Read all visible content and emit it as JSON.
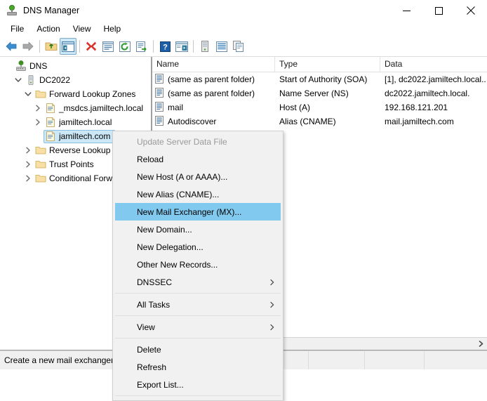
{
  "window": {
    "title": "DNS Manager",
    "icon": "dns-server-icon",
    "minimize_label": "Minimize",
    "maximize_label": "Maximize",
    "close_label": "Close"
  },
  "menubar": {
    "items": [
      {
        "label": "File",
        "name": "menu-file"
      },
      {
        "label": "Action",
        "name": "menu-action"
      },
      {
        "label": "View",
        "name": "menu-view"
      },
      {
        "label": "Help",
        "name": "menu-help"
      }
    ]
  },
  "toolbar": {
    "buttons": [
      {
        "icon": "back-arrow-icon",
        "active": false
      },
      {
        "icon": "forward-arrow-icon",
        "active": false
      },
      {
        "icon": "up-folder-icon",
        "active": false
      },
      {
        "icon": "show-hide-console-tree-icon",
        "active": true
      },
      {
        "icon": "delete-red-x-icon",
        "active": false
      },
      {
        "icon": "properties-icon",
        "active": false
      },
      {
        "icon": "refresh-icon",
        "active": false
      },
      {
        "icon": "export-list-icon",
        "active": false
      },
      {
        "icon": "help-icon",
        "active": false
      },
      {
        "icon": "show-window-icon",
        "active": false
      },
      {
        "icon": "server-icon",
        "active": false
      },
      {
        "icon": "list-view-icon",
        "active": false
      },
      {
        "icon": "copy-icon",
        "active": false
      }
    ]
  },
  "tree": {
    "items": [
      {
        "label": "DNS",
        "indent": 0,
        "icon": "dns-root-icon",
        "expander": "none",
        "selected": false
      },
      {
        "label": "DC2022",
        "indent": 1,
        "icon": "server-tower-icon",
        "expander": "expanded",
        "selected": false
      },
      {
        "label": "Forward Lookup Zones",
        "indent": 2,
        "icon": "folder-icon",
        "expander": "expanded",
        "selected": false
      },
      {
        "label": "_msdcs.jamiltech.local",
        "indent": 3,
        "icon": "zone-icon",
        "expander": "collapsed",
        "selected": false
      },
      {
        "label": "jamiltech.local",
        "indent": 3,
        "icon": "zone-icon",
        "expander": "collapsed",
        "selected": false
      },
      {
        "label": "jamiltech.com",
        "indent": 3,
        "icon": "zone-icon",
        "expander": "none",
        "selected": true
      },
      {
        "label": "Reverse Lookup Zones",
        "indent": 2,
        "icon": "folder-icon",
        "expander": "collapsed",
        "selected": false
      },
      {
        "label": "Trust Points",
        "indent": 2,
        "icon": "folder-icon",
        "expander": "collapsed",
        "selected": false
      },
      {
        "label": "Conditional Forwarders",
        "indent": 2,
        "icon": "folder-icon",
        "expander": "collapsed",
        "selected": false
      }
    ]
  },
  "list": {
    "columns": [
      {
        "label": "Name"
      },
      {
        "label": "Type"
      },
      {
        "label": "Data"
      }
    ],
    "rows": [
      {
        "name": "(same as parent folder)",
        "type": "Start of Authority (SOA)",
        "data": "[1], dc2022.jamiltech.local.."
      },
      {
        "name": "(same as parent folder)",
        "type": "Name Server (NS)",
        "data": "dc2022.jamiltech.local."
      },
      {
        "name": "mail",
        "type": "Host (A)",
        "data": "192.168.121.201"
      },
      {
        "name": "Autodiscover",
        "type": "Alias (CNAME)",
        "data": "mail.jamiltech.com"
      }
    ]
  },
  "context_menu": {
    "items": [
      {
        "label": "Update Server Data File",
        "state": "disabled",
        "submenu": false,
        "separator_after": false
      },
      {
        "label": "Reload",
        "state": "normal",
        "submenu": false,
        "separator_after": false
      },
      {
        "label": "New Host (A or AAAA)...",
        "state": "normal",
        "submenu": false,
        "separator_after": false
      },
      {
        "label": "New Alias (CNAME)...",
        "state": "normal",
        "submenu": false,
        "separator_after": false
      },
      {
        "label": "New Mail Exchanger (MX)...",
        "state": "highlight",
        "submenu": false,
        "separator_after": false
      },
      {
        "label": "New Domain...",
        "state": "normal",
        "submenu": false,
        "separator_after": false
      },
      {
        "label": "New Delegation...",
        "state": "normal",
        "submenu": false,
        "separator_after": false
      },
      {
        "label": "Other New Records...",
        "state": "normal",
        "submenu": false,
        "separator_after": false
      },
      {
        "label": "DNSSEC",
        "state": "normal",
        "submenu": true,
        "separator_after": true
      },
      {
        "label": "All Tasks",
        "state": "normal",
        "submenu": true,
        "separator_after": true
      },
      {
        "label": "View",
        "state": "normal",
        "submenu": true,
        "separator_after": true
      },
      {
        "label": "Delete",
        "state": "normal",
        "submenu": false,
        "separator_after": false
      },
      {
        "label": "Refresh",
        "state": "normal",
        "submenu": false,
        "separator_after": false
      },
      {
        "label": "Export List...",
        "state": "normal",
        "submenu": false,
        "separator_after": true
      }
    ]
  },
  "statusbar": {
    "message": "Create a new mail exchanger",
    "cell2": "",
    "cell3": "",
    "cell4": ""
  },
  "colors": {
    "highlight_blue": "#82c9ef",
    "selection_blue": "#cce8f7",
    "folder_yellow": "#f7d68a",
    "accent_green": "#4aa82a",
    "delete_red": "#d9332b"
  }
}
